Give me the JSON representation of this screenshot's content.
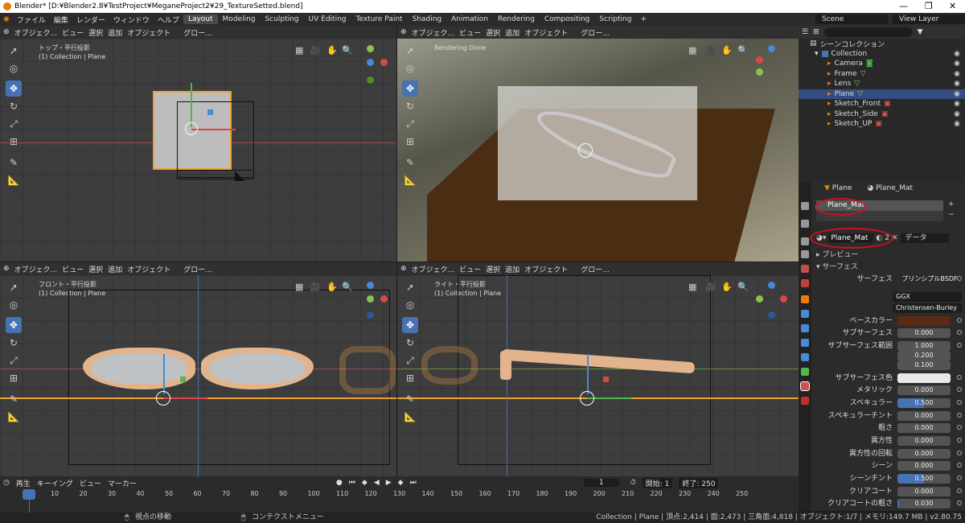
{
  "window": {
    "title": "Blender* [D:¥Blender2.8¥TestProject¥MeganeProject2¥29_TextureSetted.blend]"
  },
  "menu": [
    "ファイル",
    "編集",
    "レンダー",
    "ウィンドウ",
    "ヘルプ"
  ],
  "workspaces": [
    "Layout",
    "Modeling",
    "Sculpting",
    "UV Editing",
    "Texture Paint",
    "Shading",
    "Animation",
    "Rendering",
    "Compositing",
    "Scripting"
  ],
  "add_workspace": "+",
  "scene": "Scene",
  "view_layer": "View Layer",
  "viewport_header": {
    "mode": "オブジェク...",
    "view": "ビュー",
    "select": "選択",
    "add": "追加",
    "object": "オブジェクト",
    "transform": "グロー..."
  },
  "viewports": [
    {
      "title": "トップ・平行投影",
      "subtitle": "(1) Collection | Plane"
    },
    {
      "title": "Rendering Done",
      "subtitle": ""
    },
    {
      "title": "フロント・平行投影",
      "subtitle": "(1) Collection | Plane"
    },
    {
      "title": "ライト・平行投影",
      "subtitle": "(1) Collection | Plane"
    }
  ],
  "outliner": {
    "root": "シーンコレクション",
    "collection": "Collection",
    "items": [
      "Camera",
      "Frame",
      "Lens",
      "Plane",
      "Sketch_Front",
      "Sketch_Side",
      "Sketch_UP"
    ]
  },
  "properties": {
    "breadcrumb_object": "Plane",
    "breadcrumb_material": "Plane_Mat",
    "slot": "Plane_Mat",
    "material_name": "Plane_Mat",
    "users": "2",
    "link": "データ",
    "preview": "プレビュー",
    "surface_panel": "サーフェス",
    "surface_label": "サーフェス",
    "surface_value": "プリンシプルBSDF",
    "distribution": "GGX",
    "subsurface_method": "Christensen-Burley",
    "rows": [
      {
        "label": "ベースカラー",
        "value": ""
      },
      {
        "label": "サブサーフェス",
        "value": "0.000"
      },
      {
        "label": "サブサーフェス範囲",
        "value": "1.000"
      },
      {
        "label": "",
        "value": "0.200"
      },
      {
        "label": "",
        "value": "0.100"
      },
      {
        "label": "サブサーフェス色",
        "value": ""
      },
      {
        "label": "メタリック",
        "value": "0.000"
      },
      {
        "label": "スペキュラー",
        "value": "0.500"
      },
      {
        "label": "スペキュラーチント",
        "value": "0.000"
      },
      {
        "label": "粗さ",
        "value": "0.000"
      },
      {
        "label": "異方性",
        "value": "0.000"
      },
      {
        "label": "異方性の回転",
        "value": "0.000"
      },
      {
        "label": "シーン",
        "value": "0.000"
      },
      {
        "label": "シーンチント",
        "value": "0.500"
      },
      {
        "label": "クリアコート",
        "value": "0.000"
      },
      {
        "label": "クリアコートの粗さ",
        "value": "0.030"
      }
    ],
    "colors": {
      "base": "#5a2a12",
      "subsurface": "#e8e8e8",
      "accent": "#4772b3"
    }
  },
  "timeline": {
    "play": "再生",
    "keying": "キーイング",
    "view": "ビュー",
    "marker": "マーカー",
    "current": "1",
    "start_label": "開始:",
    "start": "1",
    "end_label": "終了:",
    "end": "250",
    "ticks": [
      "1",
      "10",
      "20",
      "30",
      "40",
      "50",
      "60",
      "70",
      "80",
      "90",
      "100",
      "110",
      "120",
      "130",
      "140",
      "150",
      "160",
      "170",
      "180",
      "190",
      "200",
      "210",
      "220",
      "230",
      "240",
      "250"
    ]
  },
  "status": {
    "left": "視点の移動",
    "mid": "コンテクストメニュー",
    "right": "Collection | Plane | 頂点:2,414 | 面:2,473 | 三角面:4,818 | オブジェクト:1/7 | メモリ:149.7 MB | v2.80.75"
  }
}
